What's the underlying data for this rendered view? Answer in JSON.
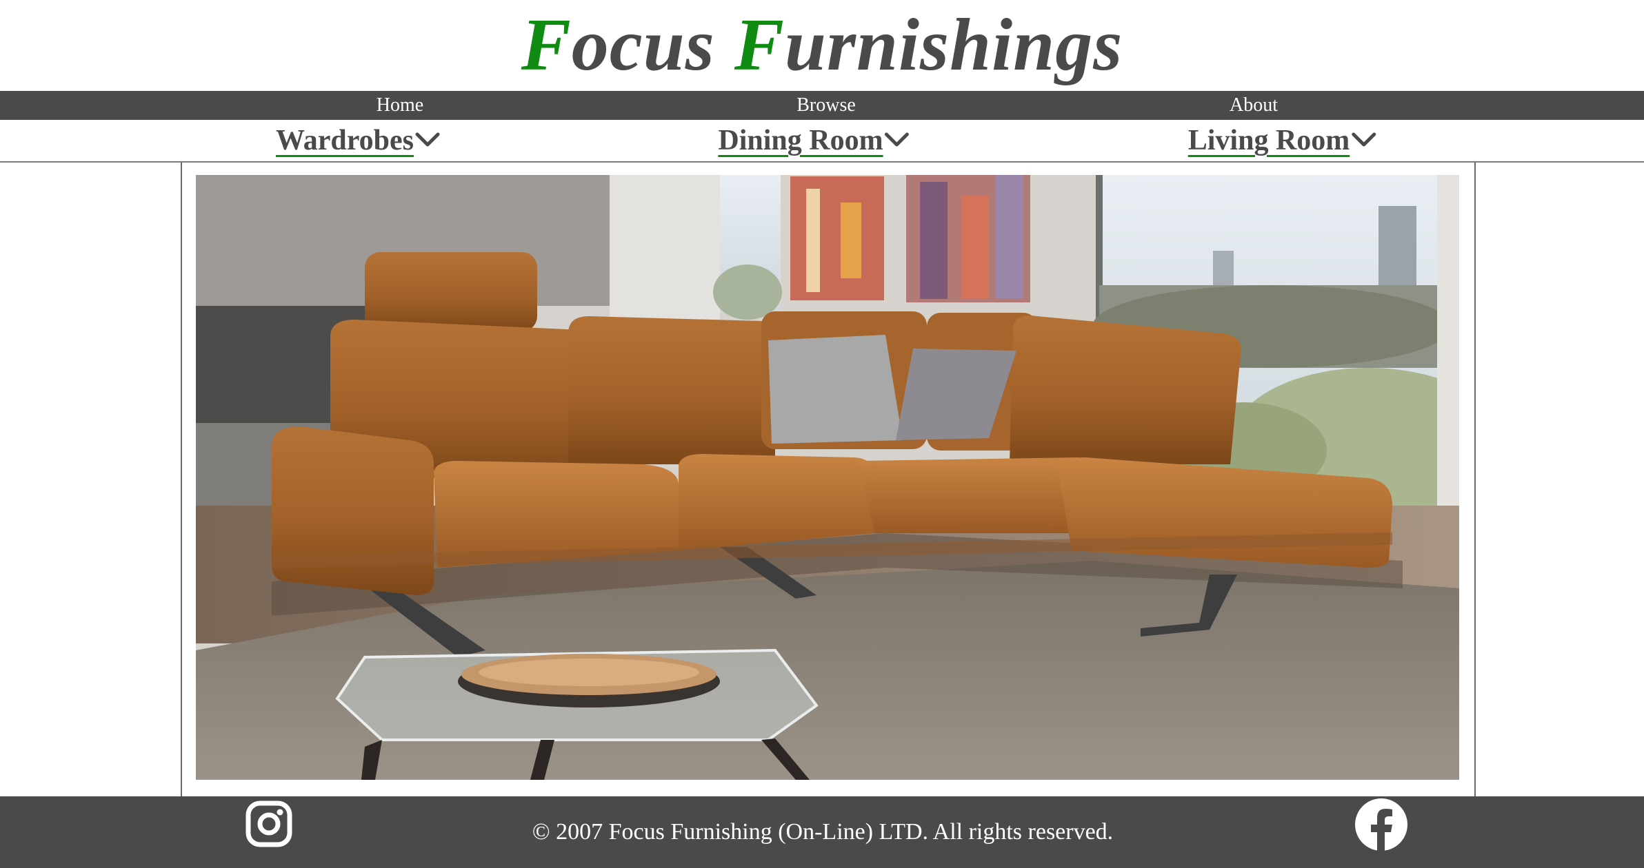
{
  "brand": {
    "name_cap1": "F",
    "name_rest1": "ocus ",
    "name_cap2": "F",
    "name_rest2": "urnishings",
    "accent_color": "#0f8a12",
    "text_color": "#4a4a4a"
  },
  "nav": {
    "items": [
      {
        "label": "Home"
      },
      {
        "label": "Browse"
      },
      {
        "label": "About"
      }
    ],
    "background": "#4a4a4a"
  },
  "categories": [
    {
      "label": "Wardrobes",
      "icon": "chevron-down-icon"
    },
    {
      "label": "Dining Room",
      "icon": "chevron-down-icon"
    },
    {
      "label": "Living Room",
      "icon": "chevron-down-icon"
    }
  ],
  "hero": {
    "image": "hero-image"
  },
  "footer": {
    "copyright": "© 2007 Focus Furnishing (On-Line) LTD. All rights reserved.",
    "left_icon": "instagram-icon",
    "right_icon": "facebook-icon"
  }
}
